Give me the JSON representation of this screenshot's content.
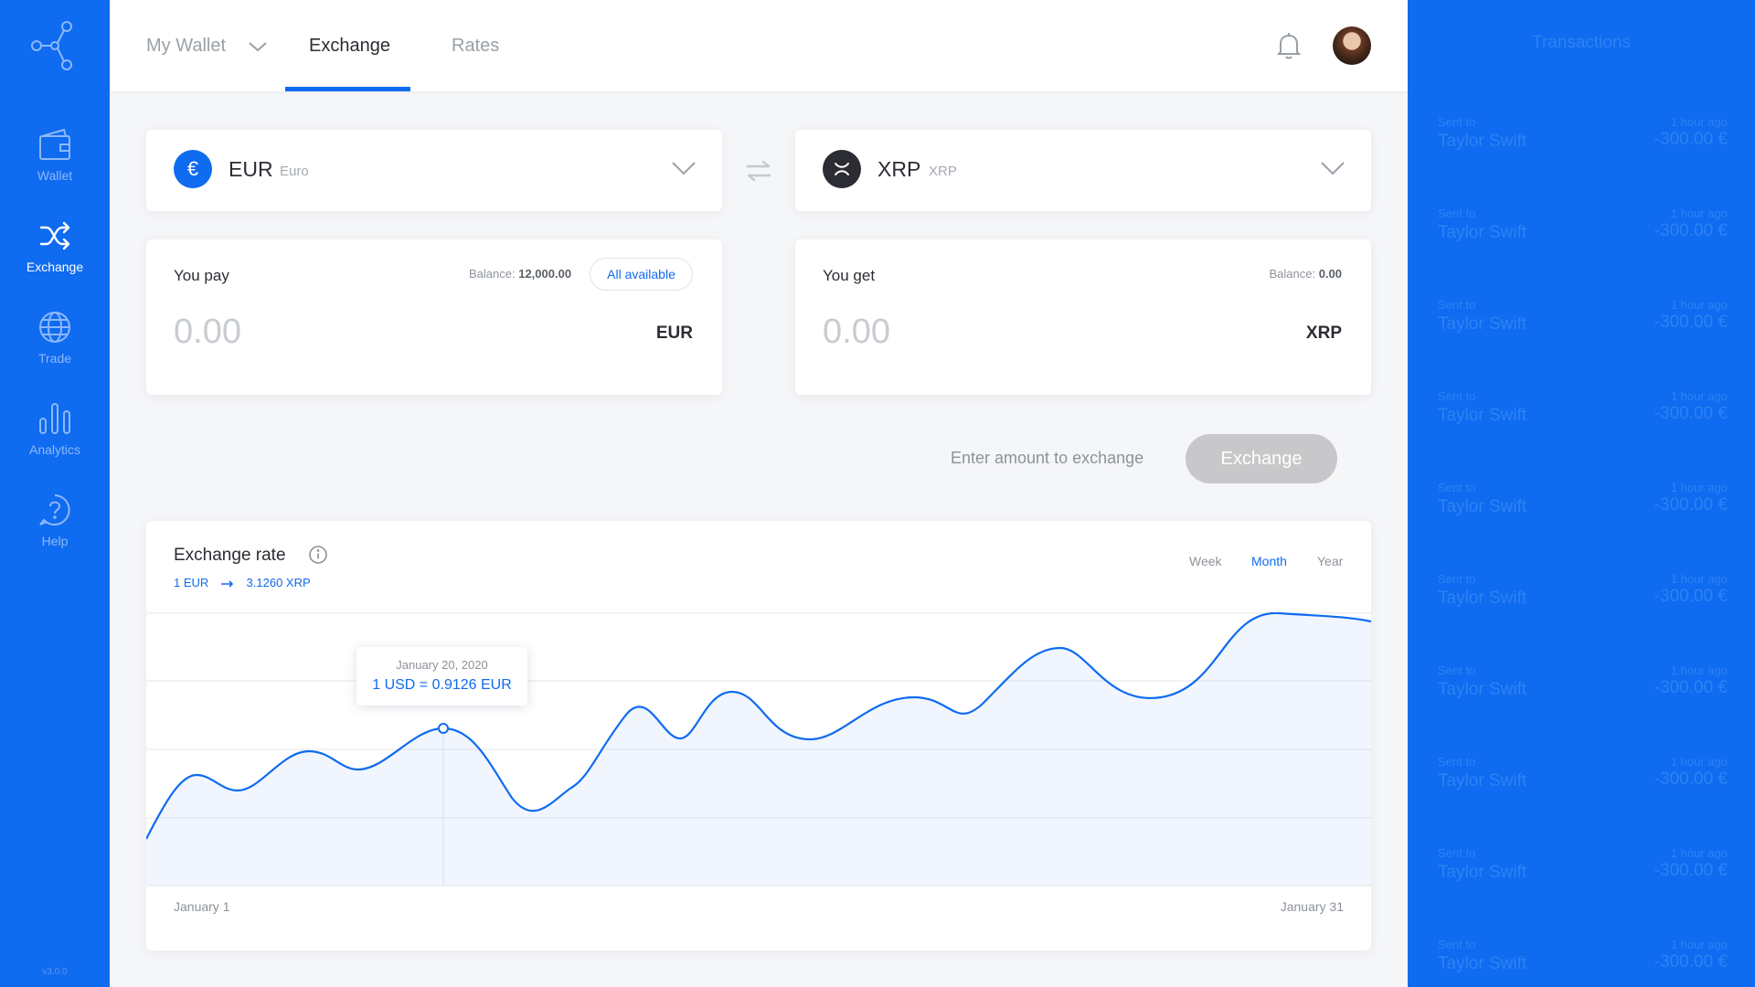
{
  "nav": {
    "items": [
      {
        "label": "Wallet",
        "icon": "wallet-icon"
      },
      {
        "label": "Exchange",
        "icon": "shuffle-icon"
      },
      {
        "label": "Trade",
        "icon": "globe-icon"
      },
      {
        "label": "Analytics",
        "icon": "bar-chart-icon"
      },
      {
        "label": "Help",
        "icon": "help-icon"
      }
    ],
    "version": "v3.0.0"
  },
  "header": {
    "tabs": [
      {
        "label": "My Wallet"
      },
      {
        "label": "Exchange"
      },
      {
        "label": "Rates"
      }
    ],
    "active_tab": "Exchange"
  },
  "from": {
    "code": "EUR",
    "name": "Euro",
    "symbol": "€",
    "pay_label": "You pay",
    "balance_label": "Balance:",
    "balance": "12,000.00",
    "all_available": "All available",
    "amount": "0.00",
    "amount_currency": "EUR"
  },
  "to": {
    "code": "XRP",
    "name": "XRP",
    "symbol": "✕",
    "get_label": "You get",
    "balance_label": "Balance:",
    "balance": "0.00",
    "amount": "0.00",
    "amount_currency": "XRP"
  },
  "exchange": {
    "hint": "Enter amount to exchange",
    "button": "Exchange"
  },
  "rate": {
    "title": "Exchange rate",
    "from": "1 EUR",
    "to": "3.1260 XRP",
    "periods": [
      "Week",
      "Month",
      "Year"
    ],
    "active_period": "Month",
    "x_start": "January 1",
    "x_end": "January 31",
    "tooltip_date": "January 20, 2020",
    "tooltip_value": "1 USD = 0.9126 EUR"
  },
  "transactions": {
    "title": "Transactions",
    "items": [
      {
        "kind": "Sent to",
        "name": "Taylor Swift",
        "time": "1 hour ago",
        "amount": "-300.00 €"
      },
      {
        "kind": "Sent to",
        "name": "Taylor Swift",
        "time": "1 hour ago",
        "amount": "-300.00 €"
      },
      {
        "kind": "Sent to",
        "name": "Taylor Swift",
        "time": "1 hour ago",
        "amount": "-300.00 €"
      },
      {
        "kind": "Sent to",
        "name": "Taylor Swift",
        "time": "1 hour ago",
        "amount": "-300.00 €"
      },
      {
        "kind": "Sent to",
        "name": "Taylor Swift",
        "time": "1 hour ago",
        "amount": "-300.00 €"
      },
      {
        "kind": "Sent to",
        "name": "Taylor Swift",
        "time": "1 hour ago",
        "amount": "-300.00 €"
      },
      {
        "kind": "Sent to",
        "name": "Taylor Swift",
        "time": "1 hour ago",
        "amount": "-300.00 €"
      },
      {
        "kind": "Sent to",
        "name": "Taylor Swift",
        "time": "1 hour ago",
        "amount": "-300.00 €"
      },
      {
        "kind": "Sent to",
        "name": "Taylor Swift",
        "time": "1 hour ago",
        "amount": "-300.00 €"
      },
      {
        "kind": "Sent to",
        "name": "Taylor Swift",
        "time": "1 hour ago",
        "amount": "-300.00 €"
      }
    ]
  },
  "colors": {
    "accent": "#0f6bf0",
    "disabled_button": "#c8c8ca",
    "xrp_badge": "#2b2d33"
  }
}
